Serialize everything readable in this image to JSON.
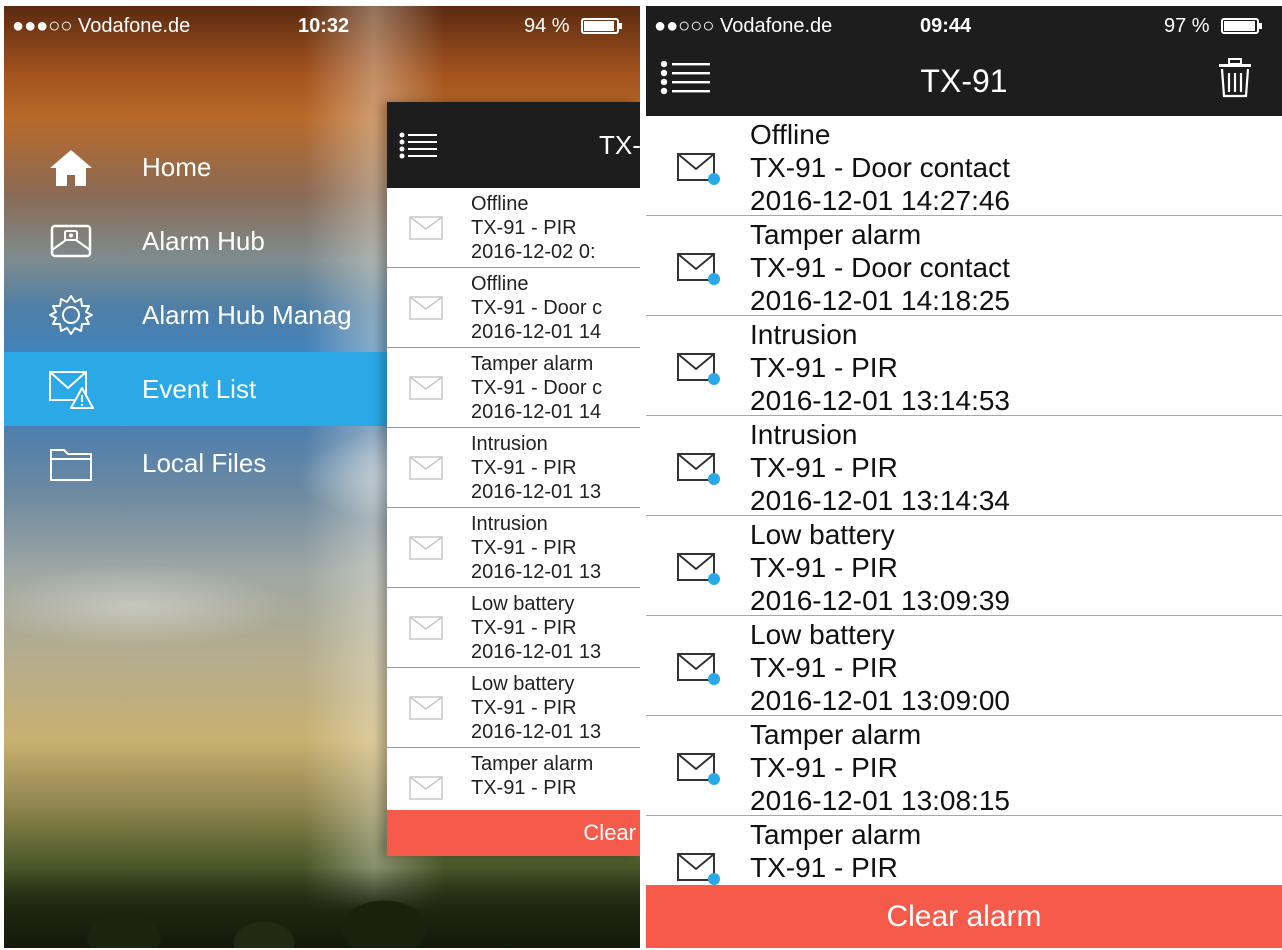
{
  "left_screen": {
    "status_bar": {
      "carrier": "●●●○○ Vodafone.de",
      "time": "10:32",
      "battery": "94 %"
    },
    "menu": [
      {
        "label": "Home",
        "icon": "home-icon"
      },
      {
        "label": "Alarm Hub",
        "icon": "alarm-hub-icon"
      },
      {
        "label": "Alarm Hub Manag",
        "icon": "gear-icon"
      },
      {
        "label": "Event List",
        "icon": "event-list-icon",
        "active": true
      },
      {
        "label": "Local Files",
        "icon": "folder-icon"
      }
    ],
    "panel": {
      "title": "TX-",
      "events": [
        {
          "title": "Offline",
          "source": "TX-91 - PIR",
          "time": "2016-12-02 0:"
        },
        {
          "title": "Offline",
          "source": "TX-91 - Door c",
          "time": "2016-12-01 14"
        },
        {
          "title": "Tamper alarm",
          "source": "TX-91 - Door c",
          "time": "2016-12-01 14"
        },
        {
          "title": "Intrusion",
          "source": "TX-91 - PIR",
          "time": "2016-12-01 13"
        },
        {
          "title": "Intrusion",
          "source": "TX-91 - PIR",
          "time": "2016-12-01 13"
        },
        {
          "title": "Low battery",
          "source": "TX-91 - PIR",
          "time": "2016-12-01 13"
        },
        {
          "title": "Low battery",
          "source": "TX-91 - PIR",
          "time": "2016-12-01 13"
        },
        {
          "title": "Tamper alarm",
          "source": "TX-91 - PIR",
          "time": ""
        }
      ],
      "clear_label": "Clear"
    }
  },
  "right_screen": {
    "status_bar": {
      "carrier": "●●○○○ Vodafone.de",
      "time": "09:44",
      "battery": "97 %"
    },
    "title": "TX-91",
    "events": [
      {
        "title": "Offline",
        "source": "TX-91 - Door contact",
        "time": "2016-12-01 14:27:46"
      },
      {
        "title": "Tamper alarm",
        "source": "TX-91 - Door contact",
        "time": "2016-12-01 14:18:25"
      },
      {
        "title": "Intrusion",
        "source": "TX-91 - PIR",
        "time": "2016-12-01 13:14:53"
      },
      {
        "title": "Intrusion",
        "source": "TX-91 - PIR",
        "time": "2016-12-01 13:14:34"
      },
      {
        "title": "Low battery",
        "source": "TX-91 - PIR",
        "time": "2016-12-01 13:09:39"
      },
      {
        "title": "Low battery",
        "source": "TX-91 - PIR",
        "time": "2016-12-01 13:09:00"
      },
      {
        "title": "Tamper alarm",
        "source": "TX-91 - PIR",
        "time": "2016-12-01 13:08:15"
      },
      {
        "title": "Tamper alarm",
        "source": "TX-91 - PIR",
        "time": ""
      }
    ],
    "clear_label": "Clear alarm"
  },
  "colors": {
    "accent_blue": "#2aa9e6",
    "clear_red": "#f55a4b",
    "header_dark": "#1d1d1d",
    "unread_dot": "#2aa9e6"
  }
}
